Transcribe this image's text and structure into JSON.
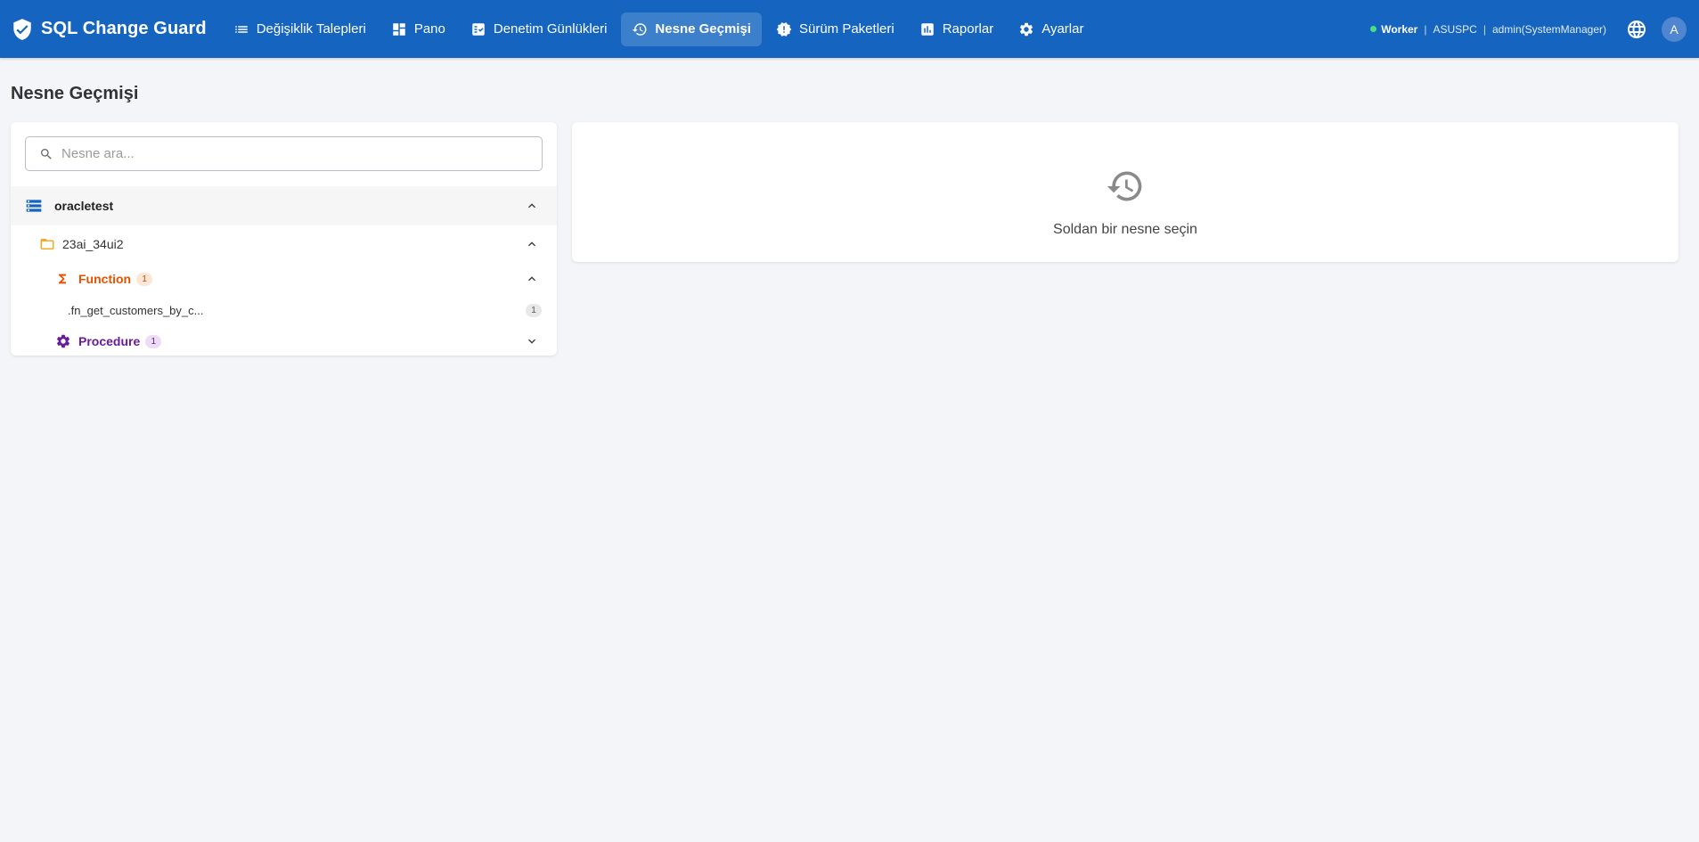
{
  "app": {
    "title": "SQL Change Guard"
  },
  "nav": {
    "items": [
      {
        "label": "Değişiklik Talepleri",
        "icon": "list-icon"
      },
      {
        "label": "Pano",
        "icon": "dashboard-icon"
      },
      {
        "label": "Denetim Günlükleri",
        "icon": "audit-log-icon"
      },
      {
        "label": "Nesne Geçmişi",
        "icon": "history-icon",
        "active": true
      },
      {
        "label": "Sürüm Paketleri",
        "icon": "release-badge-icon"
      },
      {
        "label": "Raporlar",
        "icon": "bar-chart-icon"
      },
      {
        "label": "Ayarlar",
        "icon": "gear-icon"
      }
    ]
  },
  "status": {
    "worker_label": "Worker",
    "host": "ASUSPC",
    "user": "admin(SystemManager)",
    "worker_color": "#4ade80"
  },
  "avatar": {
    "initial": "A"
  },
  "page": {
    "title": "Nesne Geçmişi"
  },
  "search": {
    "placeholder": "Nesne ara..."
  },
  "tree": {
    "database": {
      "label": "oracletest",
      "icon": "database-icon"
    },
    "schema": {
      "label": "23ai_34ui2",
      "icon": "folder-icon"
    },
    "function_group": {
      "label": "Function",
      "count": "1",
      "icon": "sigma-icon"
    },
    "function_object": {
      "label": ".fn_get_customers_by_c...",
      "count": "1"
    },
    "procedure_group": {
      "label": "Procedure",
      "count": "1",
      "icon": "gear-icon"
    }
  },
  "detail": {
    "empty_text": "Soldan bir nesne seçin",
    "icon": "history-icon"
  },
  "colors": {
    "primary": "#1565c0",
    "function": "#e65100",
    "procedure": "#6a1b9a",
    "folder": "#f9a825"
  }
}
